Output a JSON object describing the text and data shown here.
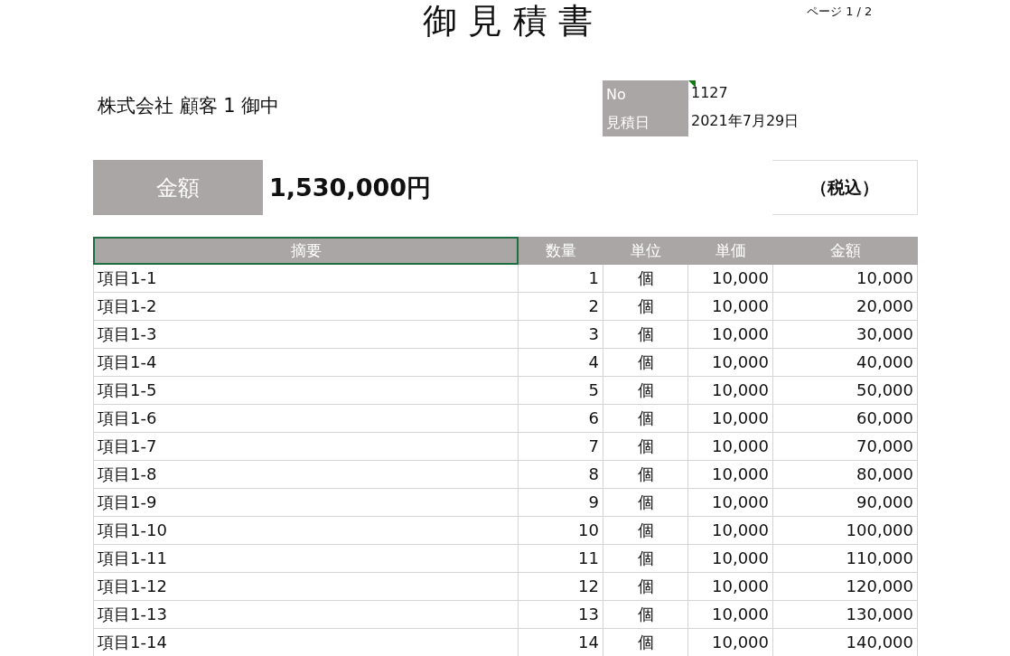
{
  "title": "御見積書",
  "page_label": "ページ 1 / 2",
  "customer": "株式会社 顧客 1  御中",
  "meta": [
    {
      "label": "No",
      "value": "1127",
      "comment": true
    },
    {
      "label": "見積日",
      "value": "2021年7月29日",
      "comment": false
    }
  ],
  "total": {
    "label": "金額",
    "amount": "1,530,000円",
    "tax_note": "（税込）"
  },
  "table": {
    "columns": [
      {
        "label": "摘要",
        "selected": true
      },
      {
        "label": "数量",
        "selected": false
      },
      {
        "label": "単位",
        "selected": false
      },
      {
        "label": "単価",
        "selected": false
      },
      {
        "label": "金額",
        "selected": false
      }
    ],
    "rows": [
      [
        "項目1-1",
        "1",
        "個",
        "10,000",
        "10,000"
      ],
      [
        "項目1-2",
        "2",
        "個",
        "10,000",
        "20,000"
      ],
      [
        "項目1-3",
        "3",
        "個",
        "10,000",
        "30,000"
      ],
      [
        "項目1-4",
        "4",
        "個",
        "10,000",
        "40,000"
      ],
      [
        "項目1-5",
        "5",
        "個",
        "10,000",
        "50,000"
      ],
      [
        "項目1-6",
        "6",
        "個",
        "10,000",
        "60,000"
      ],
      [
        "項目1-7",
        "7",
        "個",
        "10,000",
        "70,000"
      ],
      [
        "項目1-8",
        "8",
        "個",
        "10,000",
        "80,000"
      ],
      [
        "項目1-9",
        "9",
        "個",
        "10,000",
        "90,000"
      ],
      [
        "項目1-10",
        "10",
        "個",
        "10,000",
        "100,000"
      ],
      [
        "項目1-11",
        "11",
        "個",
        "10,000",
        "110,000"
      ],
      [
        "項目1-12",
        "12",
        "個",
        "10,000",
        "120,000"
      ],
      [
        "項目1-13",
        "13",
        "個",
        "10,000",
        "130,000"
      ],
      [
        "項目1-14",
        "14",
        "個",
        "10,000",
        "140,000"
      ]
    ]
  }
}
